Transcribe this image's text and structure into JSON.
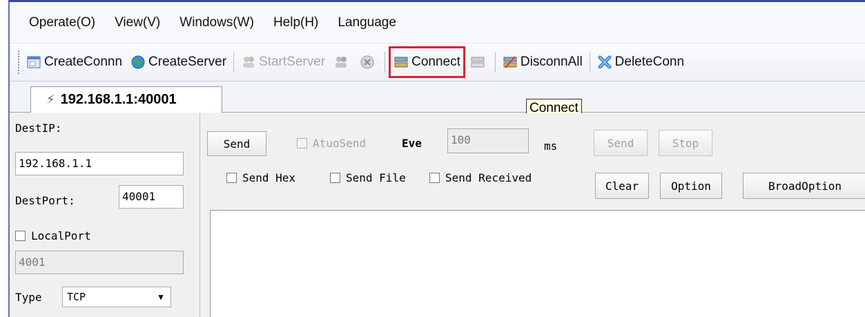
{
  "menu": [
    "Operate(O)",
    "View(V)",
    "Windows(W)",
    "Help(H)",
    "Language"
  ],
  "toolbar": {
    "create_conn": "CreateConnn",
    "create_server": "CreateServer",
    "start_server": "StartServer",
    "connect": "Connect",
    "disconn_all": "DisconnAll",
    "delete_conn": "DeleteConn"
  },
  "tab": {
    "label": "192.168.1.1:40001"
  },
  "tooltip": "Connect",
  "left_panel": {
    "dest_ip_label": "DestIP:",
    "dest_ip_value": "192.168.1.1",
    "dest_port_label": "DestPort:",
    "dest_port_value": "40001",
    "local_port_label": "LocalPort",
    "local_port_value": "4001",
    "type_label": "Type",
    "type_value": "TCP"
  },
  "right_panel": {
    "send_button": "Send",
    "auto_send_label": "AtuoSend",
    "every_label": "Eve",
    "interval_value": "100",
    "ms_label": "ms",
    "send_disabled": "Send",
    "stop_button": "Stop",
    "send_hex_label": "Send Hex",
    "send_file_label": "Send File",
    "send_received_label": "Send Received",
    "clear_button": "Clear",
    "option_button": "Option",
    "broad_option_button": "BroadOption"
  },
  "colors": {
    "highlight": "#d6262e",
    "window_border": "#3547a9"
  }
}
